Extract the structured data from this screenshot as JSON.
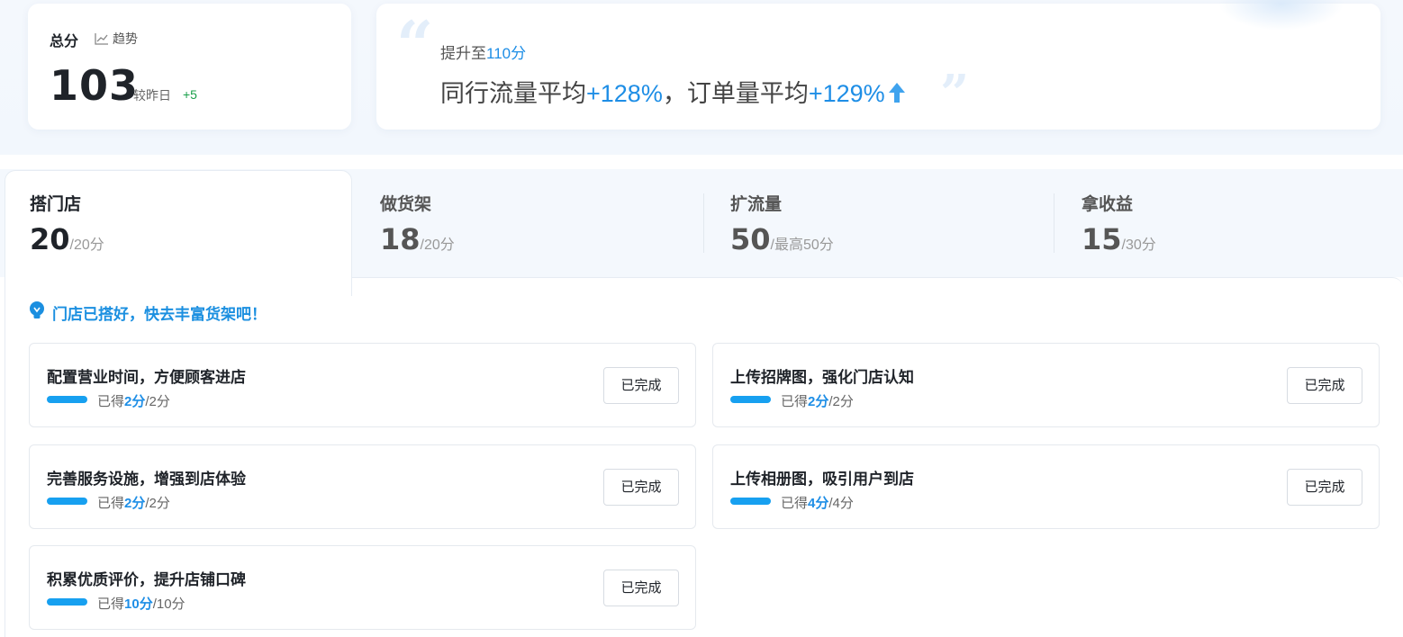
{
  "score": {
    "title": "总分",
    "trend_label": "趋势",
    "value": "103",
    "compare_label": "较昨日",
    "delta": "+5"
  },
  "promo": {
    "sub_prefix": "提升至",
    "sub_target": "110分",
    "main_prefix": "同行流量平均",
    "main_traffic": "+128%",
    "main_mid": "，订单量平均",
    "main_orders": "+129%"
  },
  "tabs": [
    {
      "name": "搭门店",
      "score": "20",
      "max": "/20分",
      "active": true
    },
    {
      "name": "做货架",
      "score": "18",
      "max": "/20分",
      "active": false
    },
    {
      "name": "扩流量",
      "score": "50",
      "max": "/最高50分",
      "active": false
    },
    {
      "name": "拿收益",
      "score": "15",
      "max": "/30分",
      "active": false
    }
  ],
  "tip": "门店已搭好，快去丰富货架吧！",
  "tasks": [
    {
      "title": "配置营业时间，方便顾客进店",
      "progress_prefix": "已得",
      "earned": "2分",
      "total": "/2分",
      "button": "已完成",
      "fraction": 1.0
    },
    {
      "title": "上传招牌图，强化门店认知",
      "progress_prefix": "已得",
      "earned": "2分",
      "total": "/2分",
      "button": "已完成",
      "fraction": 1.0
    },
    {
      "title": "完善服务设施，增强到店体验",
      "progress_prefix": "已得",
      "earned": "2分",
      "total": "/2分",
      "button": "已完成",
      "fraction": 1.0
    },
    {
      "title": "上传相册图，吸引用户到店",
      "progress_prefix": "已得",
      "earned": "4分",
      "total": "/4分",
      "button": "已完成",
      "fraction": 1.0
    },
    {
      "title": "积累优质评价，提升店铺口碑",
      "progress_prefix": "已得",
      "earned": "10分",
      "total": "/10分",
      "button": "已完成",
      "fraction": 1.0
    }
  ],
  "colors": {
    "accent": "#1e8ee6",
    "progress": "#17a0f0",
    "positive": "#1aa04a"
  }
}
